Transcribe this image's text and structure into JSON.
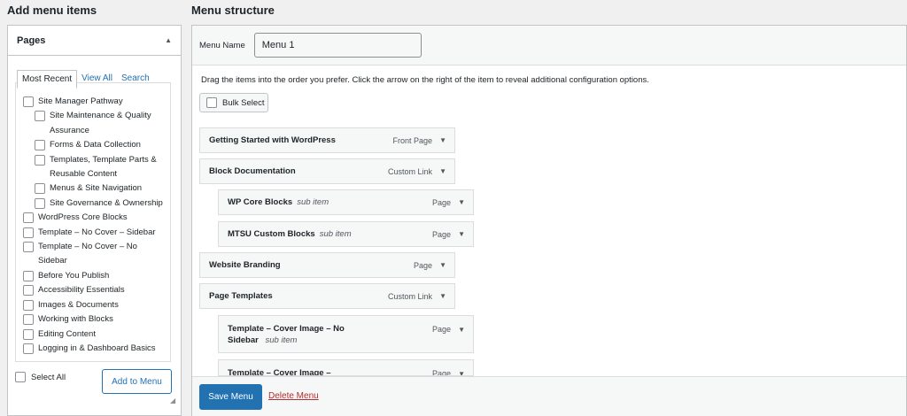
{
  "left": {
    "heading": "Add menu items",
    "panel_title": "Pages",
    "tabs": [
      "Most Recent",
      "View All",
      "Search"
    ],
    "items": [
      {
        "label": "Site Manager Pathway",
        "level": 0
      },
      {
        "label": "Site Maintenance & Quality",
        "level": 1
      },
      {
        "label": "Assurance",
        "level": "wrap"
      },
      {
        "label": "Forms & Data Collection",
        "level": 1
      },
      {
        "label": "Templates, Template Parts &",
        "level": 1
      },
      {
        "label": "Reusable Content",
        "level": "wrap"
      },
      {
        "label": "Menus & Site Navigation",
        "level": 1
      },
      {
        "label": "Site Governance & Ownership",
        "level": 1
      },
      {
        "label": "WordPress Core Blocks",
        "level": 0
      },
      {
        "label": "Template – No Cover – Sidebar",
        "level": 0
      },
      {
        "label": "Template – No Cover – No",
        "level": 0
      },
      {
        "label": "Sidebar",
        "level": "wrap0"
      },
      {
        "label": "Before You Publish",
        "level": 0
      },
      {
        "label": "Accessibility Essentials",
        "level": 0
      },
      {
        "label": "Images & Documents",
        "level": 0
      },
      {
        "label": "Working with Blocks",
        "level": 0
      },
      {
        "label": "Editing Content",
        "level": 0
      },
      {
        "label": "Logging in & Dashboard Basics",
        "level": 0
      }
    ],
    "select_all": "Select All",
    "add_button": "Add to Menu"
  },
  "right": {
    "heading": "Menu structure",
    "menu_name_label": "Menu Name",
    "menu_name_value": "Menu 1",
    "instructions": "Drag the items into the order you prefer. Click the arrow on the right of the item to reveal additional configuration options.",
    "bulk_select": "Bulk Select",
    "menu_items": [
      {
        "title": "Getting Started with WordPress",
        "sub": "",
        "type": "Front Page"
      },
      {
        "title": "Block Documentation",
        "sub": "",
        "type": "Custom Link"
      },
      {
        "title": "WP Core Blocks",
        "sub": "sub item",
        "type": "Page"
      },
      {
        "title": "MTSU Custom Blocks",
        "sub": "sub item",
        "type": "Page"
      },
      {
        "title": "Website Branding",
        "sub": "",
        "type": "Page"
      },
      {
        "title": "Page Templates",
        "sub": "",
        "type": "Custom Link"
      },
      {
        "title": "Template – Cover Image – No Sidebar",
        "sub": "sub item",
        "type": "Page"
      },
      {
        "title": "Template – Cover Image –",
        "sub": "",
        "type": "Page"
      }
    ],
    "save_button": "Save Menu",
    "delete_link": "Delete Menu"
  }
}
